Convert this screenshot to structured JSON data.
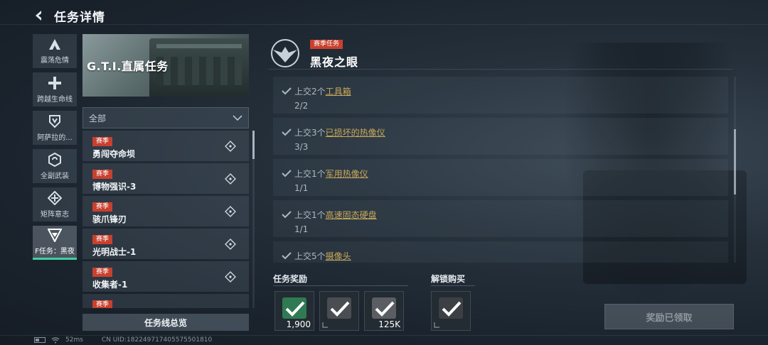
{
  "header": {
    "title": "任务详情"
  },
  "categories": [
    {
      "label": "震荡危情",
      "icon": "tri-a-icon"
    },
    {
      "label": "跨越生命线",
      "icon": "medical-cross-icon"
    },
    {
      "label": "阿萨拉的...",
      "icon": "shield-v-icon"
    },
    {
      "label": "全副武装",
      "icon": "hex-swirl-icon"
    },
    {
      "label": "矩阵意志",
      "icon": "diamond-cross-icon"
    },
    {
      "label": "F任务：黑夜",
      "icon": "triangle-v-icon"
    }
  ],
  "banner": {
    "title": "G.T.I.直属任务"
  },
  "filter": {
    "label": "全部"
  },
  "tasks": [
    {
      "tag": "赛季",
      "name": "勇闯夺命坝"
    },
    {
      "tag": "赛季",
      "name": "博物强识-3"
    },
    {
      "tag": "赛季",
      "name": "骇爪锋刃"
    },
    {
      "tag": "赛季",
      "name": "光明战士-1"
    },
    {
      "tag": "赛季",
      "name": "收集者-1"
    },
    {
      "tag": "赛季",
      "name": ""
    }
  ],
  "overview_button": "任务线总览",
  "mission": {
    "tag": "赛季任务",
    "title": "黑夜之眼"
  },
  "objectives": [
    {
      "prefix": "上交2个",
      "item": "工具箱",
      "progress": "2/2"
    },
    {
      "prefix": "上交3个",
      "item": "已损坏的热像仪",
      "progress": "3/3"
    },
    {
      "prefix": "上交1个",
      "item": "军用热像仪",
      "progress": "1/1"
    },
    {
      "prefix": "上交1个",
      "item": "高速固态硬盘",
      "progress": "1/1"
    },
    {
      "prefix": "上交5个",
      "item": "摄像头",
      "progress": ""
    }
  ],
  "rewards_label": "任务奖励",
  "rewards": [
    {
      "qty": "1,900",
      "color": "#2f7a52"
    },
    {
      "qty": "",
      "color": "#4a4e52"
    },
    {
      "qty": "125K",
      "color": "#5a5e62"
    }
  ],
  "unlock_label": "解锁购买",
  "unlocks": [
    {
      "qty": "",
      "color": "#3c4044"
    }
  ],
  "claim_button": "奖励已领取",
  "status": {
    "ping": "52ms",
    "uid": "CN UID:18224971740557550181​0"
  },
  "colors": {
    "accent": "#3fd0a0",
    "season_tag": "#c8402e",
    "item_link": "#c9a95a"
  }
}
